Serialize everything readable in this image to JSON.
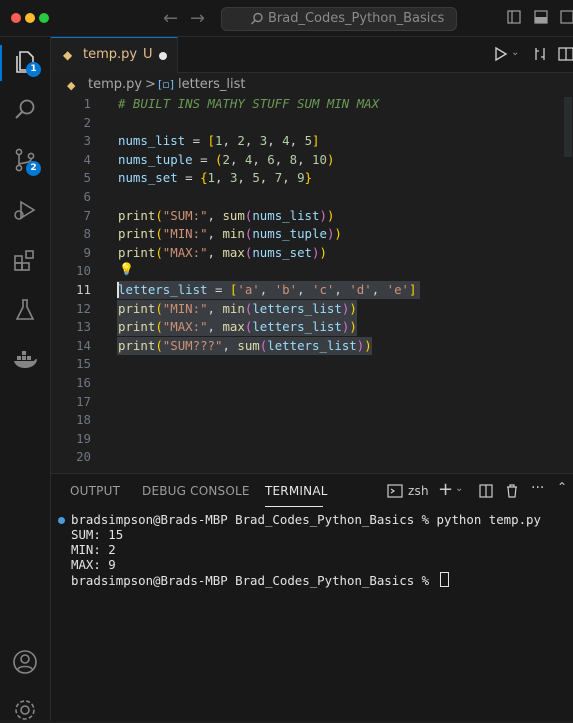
{
  "titlebar": {
    "search_text": "Brad_Codes_Python_Basics"
  },
  "activity": {
    "explorer_badge": "1",
    "source_control_badge": "2"
  },
  "tab": {
    "filename": "temp.py",
    "modified": "U"
  },
  "breadcrumb": {
    "file": "temp.py",
    "separator": ">",
    "symbol": "letters_list"
  },
  "editor": {
    "current_line": "11",
    "lines": [
      {
        "num": "1",
        "text": "# BUILT INS MATHY STUFF SUM MIN MAX"
      },
      {
        "num": "2",
        "text": ""
      },
      {
        "num": "3",
        "text": "nums_list = [1, 2, 3, 4, 5]"
      },
      {
        "num": "4",
        "text": "nums_tuple = (2, 4, 6, 8, 10)"
      },
      {
        "num": "5",
        "text": "nums_set = {1, 3, 5, 7, 9}"
      },
      {
        "num": "6",
        "text": ""
      },
      {
        "num": "7",
        "text": "print(\"SUM:\", sum(nums_list))"
      },
      {
        "num": "8",
        "text": "print(\"MIN:\", min(nums_tuple))"
      },
      {
        "num": "9",
        "text": "print(\"MAX:\", max(nums_set))"
      },
      {
        "num": "10",
        "text": ""
      },
      {
        "num": "11",
        "text": "letters_list = ['a', 'b', 'c', 'd', 'e']"
      },
      {
        "num": "12",
        "text": "print(\"MIN:\", min(letters_list))"
      },
      {
        "num": "13",
        "text": "print(\"MAX:\", max(letters_list))"
      },
      {
        "num": "14",
        "text": "print(\"SUM???\", sum(letters_list))"
      },
      {
        "num": "15",
        "text": ""
      },
      {
        "num": "16",
        "text": ""
      },
      {
        "num": "17",
        "text": ""
      },
      {
        "num": "18",
        "text": ""
      },
      {
        "num": "19",
        "text": ""
      },
      {
        "num": "20",
        "text": ""
      }
    ]
  },
  "panel": {
    "tabs": [
      "OUTPUT",
      "DEBUG CONSOLE",
      "TERMINAL"
    ],
    "active_tab": "TERMINAL",
    "shell": "zsh",
    "terminal_lines": [
      "bradsimpson@Brads-MBP Brad_Codes_Python_Basics % python temp.py",
      "SUM: 15",
      "MIN: 2",
      "MAX: 9",
      "bradsimpson@Brads-MBP Brad_Codes_Python_Basics % "
    ]
  },
  "colors": {
    "accent": "#0078d4",
    "comment": "#6a9955",
    "string": "#ce9178",
    "number": "#b5cea8",
    "variable": "#9cdcfe",
    "function": "#dcdcaa",
    "bracket1": "#ffd700",
    "bracket2": "#da70d6",
    "modified": "#e2c08d"
  }
}
